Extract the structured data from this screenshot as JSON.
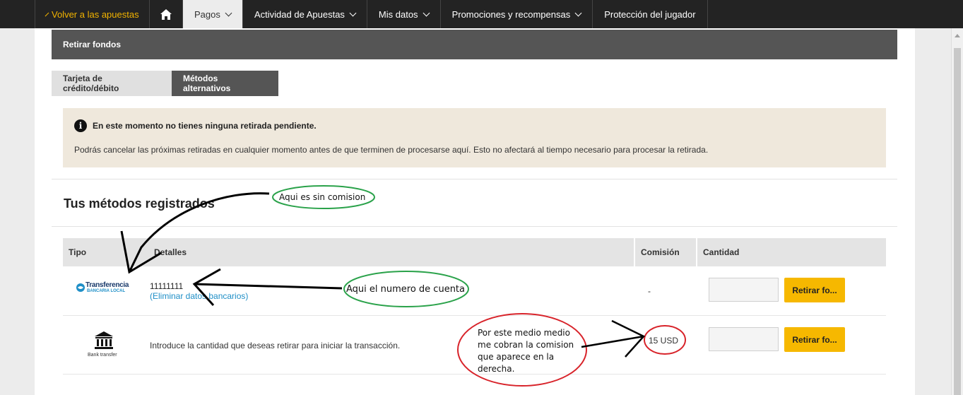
{
  "nav": {
    "back_label": "Volver a las apuestas",
    "items": [
      {
        "label": "Pagos"
      },
      {
        "label": "Actividad de Apuestas"
      },
      {
        "label": "Mis datos"
      },
      {
        "label": "Promociones y recompensas"
      },
      {
        "label": "Protección del jugador"
      }
    ]
  },
  "page": {
    "header_title": "Retirar fondos",
    "tabs": [
      {
        "label": "Tarjeta de crédito/débito",
        "active": false
      },
      {
        "label": "Métodos alternativos",
        "active": true
      }
    ],
    "notice": {
      "title": "En este momento no tienes ninguna retirada pendiente.",
      "body": "Podrás cancelar las próximas retiradas en cualquier momento antes de que terminen de procesarse aquí. Esto no afectará al tiempo necesario para procesar la retirada."
    },
    "section_title": "Tus métodos registrados",
    "table": {
      "headers": {
        "tipo": "Tipo",
        "detalles": "Detalles",
        "comision": "Comisión",
        "cantidad": "Cantidad"
      },
      "rows": [
        {
          "logo_name": "Transferencia",
          "logo_sub": "BANCARIA LOCAL",
          "detail_main": "11111111",
          "detail_link": "(Eliminar datos bancarios)",
          "fee": "-",
          "button": "Retirar fo..."
        },
        {
          "logo_label": "Bank transfer",
          "detail_main": "Introduce la cantidad que deseas retirar para iniciar la transacción.",
          "fee": "15 USD",
          "button": "Retirar fo..."
        }
      ]
    }
  },
  "annotations": {
    "note1": "Aqui es sin comision",
    "note2": "Aqui el numero de cuenta",
    "note3_lines": [
      "Por este medio medio",
      "me cobran la comision",
      "que aparece en la",
      "derecha."
    ]
  },
  "colors": {
    "accent": "#f6b800",
    "nav_bg": "#232323",
    "green_ring": "#2aa24a",
    "red_ring": "#d8232a"
  }
}
